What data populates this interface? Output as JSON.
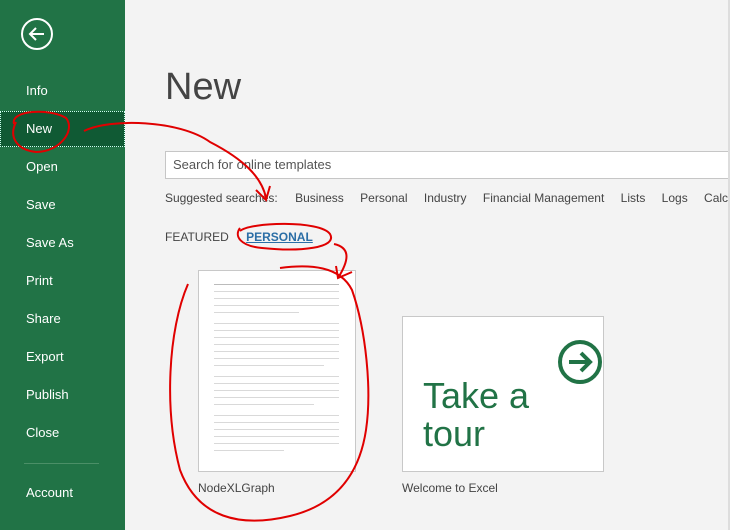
{
  "sidebar": {
    "items": [
      {
        "label": "Info"
      },
      {
        "label": "New"
      },
      {
        "label": "Open"
      },
      {
        "label": "Save"
      },
      {
        "label": "Save As"
      },
      {
        "label": "Print"
      },
      {
        "label": "Share"
      },
      {
        "label": "Export"
      },
      {
        "label": "Publish"
      },
      {
        "label": "Close"
      }
    ],
    "account": "Account"
  },
  "main": {
    "title": "New",
    "search_placeholder": "Search for online templates",
    "suggested_label": "Suggested searches:",
    "suggested": [
      "Business",
      "Personal",
      "Industry",
      "Financial Management",
      "Lists",
      "Logs",
      "Calcul"
    ],
    "tabs": [
      {
        "label": "FEATURED"
      },
      {
        "label": "PERSONAL"
      }
    ],
    "templates": [
      {
        "label": "NodeXLGraph"
      },
      {
        "label": "Welcome to Excel",
        "tour_line1": "Take a",
        "tour_line2": "tour"
      }
    ]
  },
  "colors": {
    "sidebar": "#217346",
    "accent": "#2b6ea6",
    "annotation": "#e00000"
  }
}
